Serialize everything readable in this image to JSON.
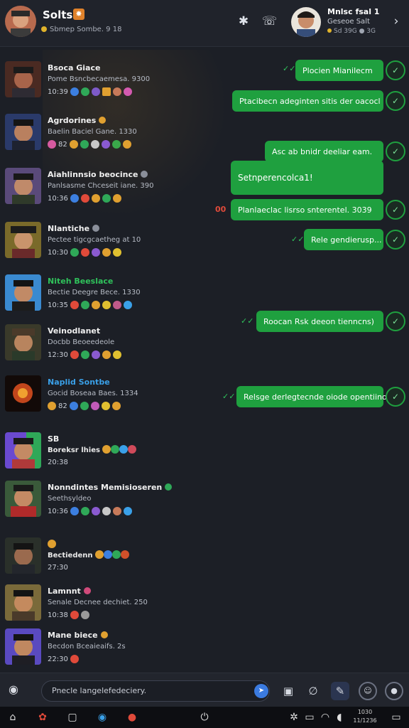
{
  "header": {
    "user_name": "Sοltsic",
    "user_status": "Sbmep Sombe. 9 18",
    "badge_icon": "fire-icon",
    "star_icon": "✱",
    "call_icon": "phone-icon",
    "peer_name": "Mnlsc fsal 1",
    "peer_sub1": "Geseoe Salt",
    "peer_sub2": "Sd 39G ● 3G",
    "menu_icon": "chevron-right-icon"
  },
  "contacts": [
    {
      "name": "Bsoca Giace",
      "sub": "Pome Bsncbecaemesa. 9300",
      "meta": "10:39",
      "name_color": "default"
    },
    {
      "name": "Agrdorines",
      "sub": "Baelin Baciel Gane. 1330",
      "meta": "82",
      "name_color": "default"
    },
    {
      "name": "Aiahlinnsio beocince",
      "sub": "Panlsasme Chceseit iane. 390",
      "meta": "10:36",
      "name_color": "default"
    },
    {
      "name": "Nlantiche",
      "sub": "Pectee tigcgcaetheg at 10",
      "meta": "10:30",
      "name_color": "default"
    },
    {
      "name": "Niteh Beeslace",
      "sub": "Bectie Deegre Bece. 1330",
      "meta": "10:35",
      "name_color": "green"
    },
    {
      "name": "Veinodlanet",
      "sub": "Docbb Beoeedeole",
      "meta": "12:30",
      "name_color": "default"
    },
    {
      "name": "Naplid Sontbe",
      "sub": "Gocid Boseaa Baes. 1334",
      "meta": "82",
      "name_color": "blue"
    },
    {
      "name": "SB",
      "sub": "Boreksr lhies",
      "meta": "20:38",
      "name_color": "default"
    },
    {
      "name": "Nonndintes Memisioseren",
      "sub": "Seethsyldeo",
      "meta": "10:36",
      "name_color": "default"
    },
    {
      "name": "",
      "sub": "Bectiedenn",
      "meta": "27:30",
      "name_color": "default"
    },
    {
      "name": "Lamnnt",
      "sub": "Senale Decnee dechiet. 250",
      "meta": "10:38",
      "name_color": "default"
    },
    {
      "name": "Mane biece",
      "sub": "Becdon Bceaieaifs. 2s",
      "meta": "22:30",
      "name_color": "default"
    }
  ],
  "messages": [
    {
      "text": "Plocien Mianilecm"
    },
    {
      "text": "Ptacibecn adeginten sitis der oacocl"
    },
    {
      "text": "Asc    ab bnidr deeliar eam."
    },
    {
      "text": "Setnperencolca1!"
    },
    {
      "text": "Planlaeclac lisrso snterentel. 3039"
    },
    {
      "text": "Rele gendierusp..."
    },
    {
      "text": "Roocan Rsk deeon tienncns)"
    },
    {
      "text": "Relsge derlegtecnde oiode opentiinon)"
    }
  ],
  "composer": {
    "placeholder": "Pnecle langelefedeciery.",
    "camera_icon": "camera-icon",
    "send_icon": "send-icon"
  },
  "taskbar": {
    "clock_line1": "1030",
    "clock_line2": "11/1236"
  },
  "colors": {
    "bubble": "#1fa03f",
    "background": "#1c1f26",
    "accent_green": "#2fc25b"
  }
}
